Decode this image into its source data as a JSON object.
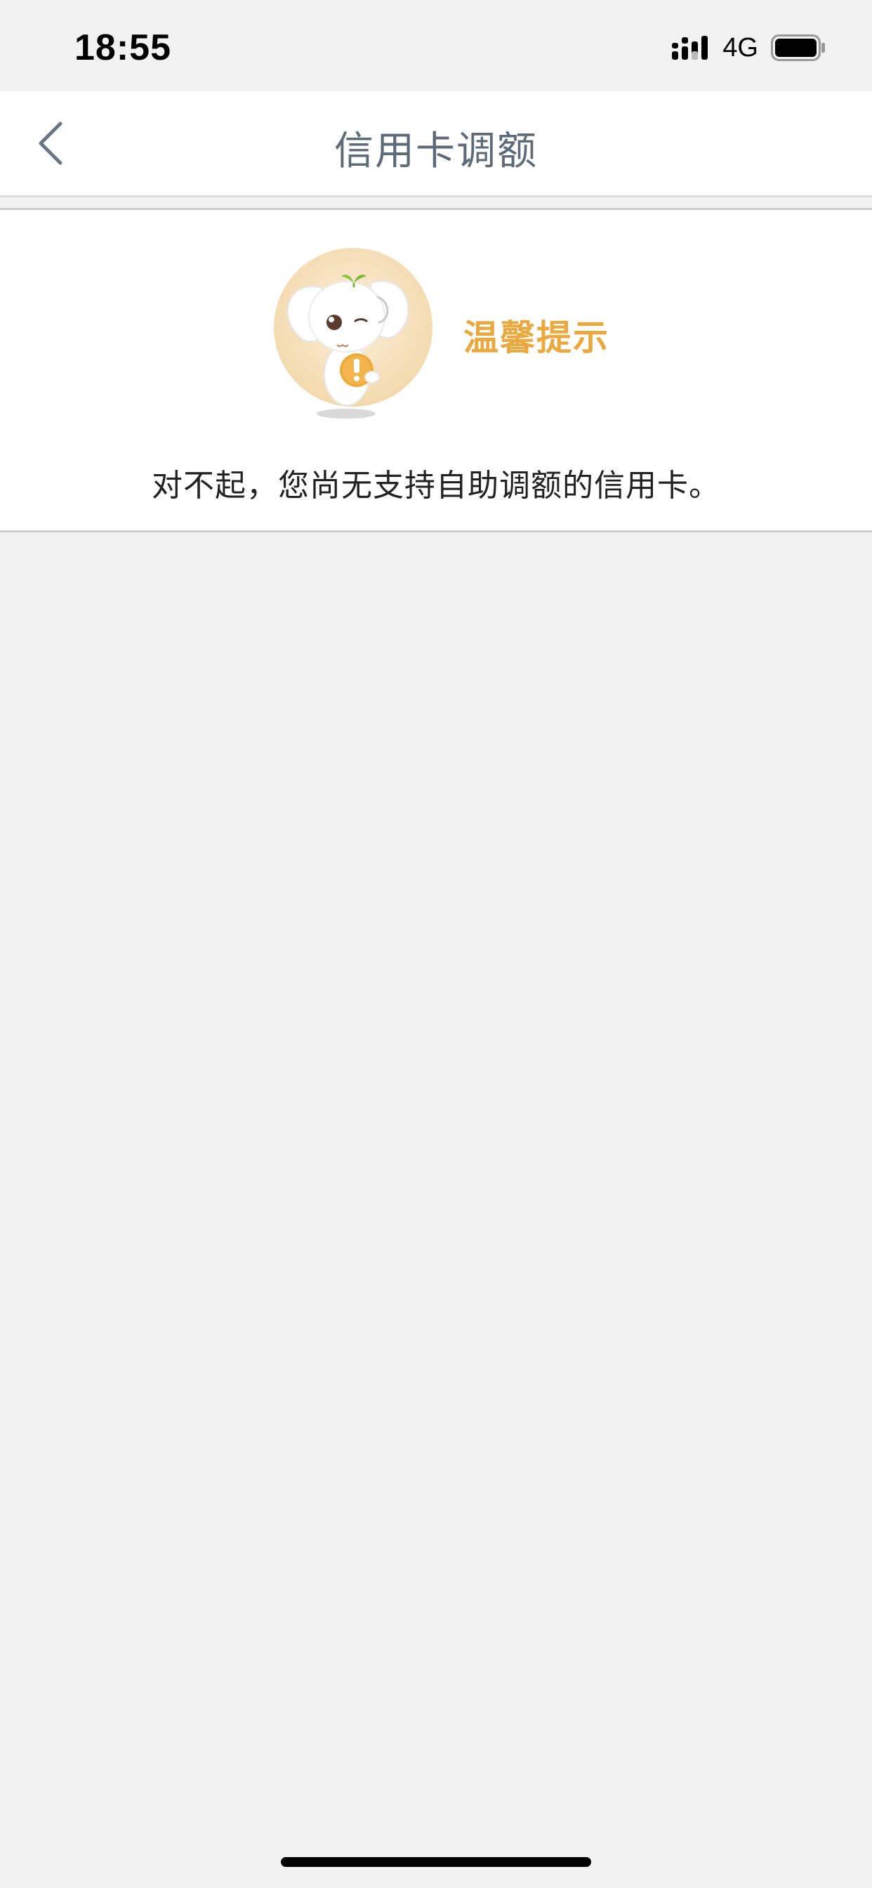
{
  "status_bar": {
    "time": "18:55",
    "network": "4G",
    "icons": [
      "signal-icon",
      "battery-icon"
    ]
  },
  "header": {
    "title": "信用卡调额",
    "back_icon": "chevron-left-icon"
  },
  "notice": {
    "mascot_icon": "elephant-mascot-icon",
    "heading": "温馨提示",
    "message": "对不起，您尚无支持自助调额的信用卡。"
  },
  "colors": {
    "accent": "#e9a93e",
    "title": "#5d6b78",
    "background": "#f2f2f2"
  }
}
